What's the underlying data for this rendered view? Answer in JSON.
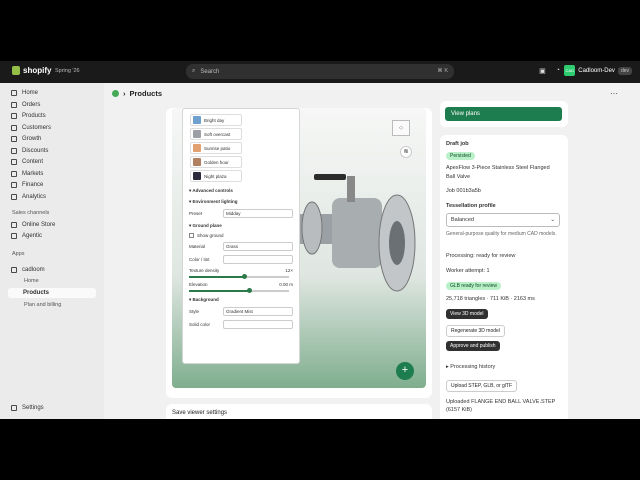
{
  "topbar": {
    "brand": "shopify",
    "season": "Spring '26",
    "search_placeholder": "Search",
    "search_shortcut": "⌘ K",
    "user_name": "Cadloom-Dev",
    "user_initials": "CAD",
    "user_tag": "dev"
  },
  "sidebar": {
    "items": [
      {
        "label": "Home"
      },
      {
        "label": "Orders"
      },
      {
        "label": "Products"
      },
      {
        "label": "Customers"
      },
      {
        "label": "Growth"
      },
      {
        "label": "Discounts"
      },
      {
        "label": "Content"
      },
      {
        "label": "Markets"
      },
      {
        "label": "Finance"
      },
      {
        "label": "Analytics"
      }
    ],
    "sales_channels_label": "Sales channels",
    "channels": [
      {
        "label": "Online Store"
      },
      {
        "label": "Agentic"
      }
    ],
    "apps_label": "Apps",
    "app_name": "cadloom",
    "app_sub": [
      {
        "label": "Home"
      },
      {
        "label": "Products"
      },
      {
        "label": "Plan and billing"
      }
    ],
    "settings": "Settings"
  },
  "page": {
    "title": "Products"
  },
  "viewer": {
    "presets": [
      {
        "label": "Bright day",
        "color": "#6f9fcf"
      },
      {
        "label": "Soft overcast",
        "color": "#9aa0a6"
      },
      {
        "label": "Sunrise patio",
        "color": "#e0a070"
      },
      {
        "label": "Golden hour",
        "color": "#b08060"
      },
      {
        "label": "Night plaza",
        "color": "#2a2a3a"
      }
    ],
    "advanced_controls": "▾ Advanced controls",
    "env_lighting": "▾ Environment lighting",
    "preset_label": "Preset",
    "preset_value": "Midday",
    "ground_plane": "▾ Ground plane",
    "show_ground": "Show ground",
    "material_label": "Material",
    "material_value": "Grass",
    "color_tint_label": "Color / tint",
    "texture_density_label": "Texture density",
    "texture_density_value": "12×",
    "texture_density_level": 0.55,
    "elevation_label": "Elevation",
    "elevation_value": "0.00 m",
    "elevation_level": 0.6,
    "background": "▾ Background",
    "style_label": "Style",
    "style_value": "Gradient Mist",
    "solid_color_label": "Solid color",
    "fab": "+",
    "save_settings": "Save viewer settings"
  },
  "right": {
    "view_plans": "View plans",
    "draft_job": "Draft job",
    "persisted": "Persisted",
    "product_name": "ApexFlow 3-Piece Stainless Steel Flanged Ball Valve",
    "job_id": "Job 001b3a5b",
    "tessellation_profile": "Tessellation profile",
    "tessellation_value": "Balanced",
    "tessellation_desc": "General-purpose quality for medium CAD models.",
    "processing": "Processing: ready for review",
    "worker_attempt": "Worker attempt: 1",
    "glb_ready": "GLB ready for review",
    "stats": "25,718 triangles · 711 KiB · 2163 ms",
    "view_3d": "View 3D model",
    "regenerate": "Regenerate 3D model",
    "approve": "Approve and publish",
    "processing_history": "▸ Processing history",
    "upload": "Upload STEP, GLB, or glTF",
    "uploaded": "Uploaded FLANGE END BALL VALVE.STEP (6157 KiB)"
  }
}
